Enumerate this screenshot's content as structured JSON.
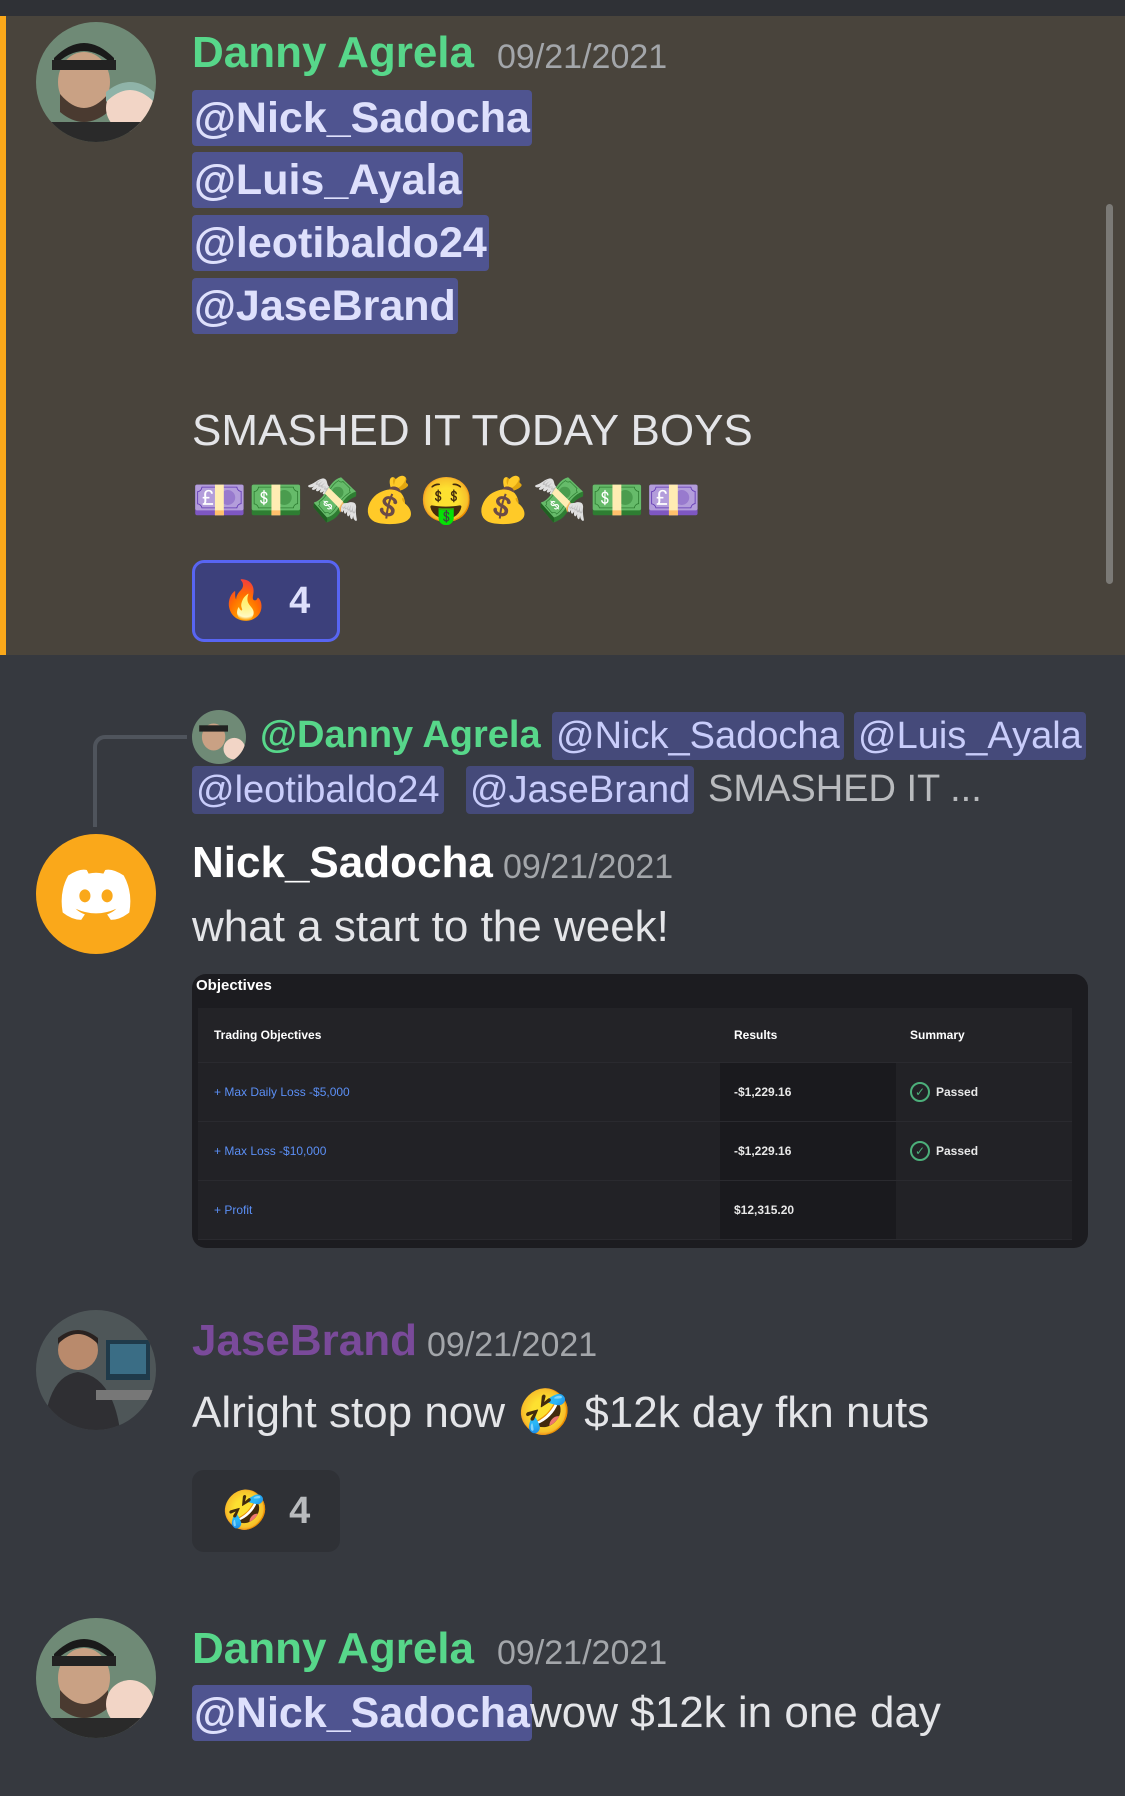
{
  "messages": [
    {
      "author": "Danny Agrela",
      "author_color": "#57d78a",
      "timestamp": "09/21/2021",
      "mentions": [
        "@Nick_Sadocha",
        "@Luis_Ayala",
        "@leotibaldo24",
        "@JaseBrand"
      ],
      "text": "SMASHED IT TODAY BOYS",
      "emojis": "💷💵💸💰🤑💰💸💵💷",
      "reaction": {
        "emoji": "🔥",
        "count": "4"
      }
    },
    {
      "reply": {
        "author": "@Danny Agrela",
        "mentions": [
          "@Nick_Sadocha",
          "@Luis_Ayala",
          "@leotibaldo24",
          "@JaseBrand"
        ],
        "text": "SMASHED IT ..."
      },
      "author": "Nick_Sadocha",
      "author_color": "#ffffff",
      "timestamp": "09/21/2021",
      "text": "what a start to the week!",
      "embed": {
        "title": "Objectives",
        "headers": [
          "Trading Objectives",
          "Results",
          "Summary"
        ],
        "rows": [
          {
            "objective": "+ Max Daily Loss -$5,000",
            "result": "-$1,229.16",
            "summary": "Passed"
          },
          {
            "objective": "+ Max Loss -$10,000",
            "result": "-$1,229.16",
            "summary": "Passed"
          },
          {
            "objective": "+ Profit",
            "result": "$12,315.20",
            "summary": ""
          }
        ]
      }
    },
    {
      "author": "JaseBrand",
      "author_color": "#7a4a9a",
      "timestamp": "09/21/2021",
      "text": "Alright stop now 🤣 $12k day fkn nuts",
      "reaction": {
        "emoji": "🤣",
        "count": "4"
      }
    },
    {
      "author": "Danny Agrela",
      "author_color": "#57d78a",
      "timestamp": "09/21/2021",
      "mention": "@Nick_Sadocha",
      "text": "wow $12k in one day"
    }
  ],
  "colors": {
    "background": "#36393f",
    "highlight": "#49443c",
    "accent_bar": "#faa81a",
    "mention_bg": "#4f5490",
    "discord_avatar": "#faa81a"
  }
}
